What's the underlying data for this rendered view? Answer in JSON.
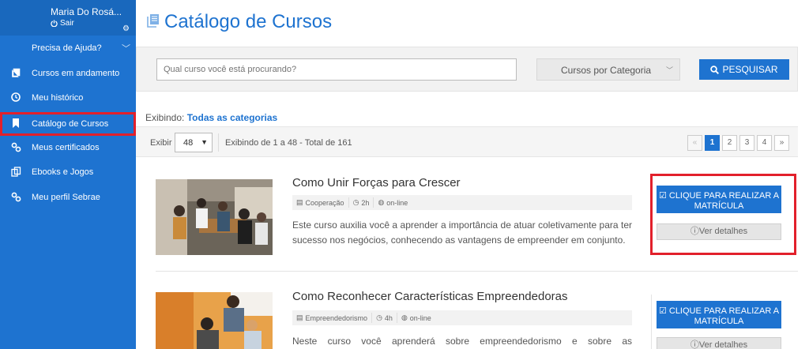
{
  "user": {
    "name": "Maria Do Rosá...",
    "logout_label": "Sair"
  },
  "sidebar": {
    "help_label": "Precisa de Ajuda?",
    "items": [
      {
        "label": "Cursos em andamento",
        "icon": "book-icon"
      },
      {
        "label": "Meu histórico",
        "icon": "clock-icon"
      },
      {
        "label": "Catálogo de Cursos",
        "icon": "bookmark-icon",
        "active": true
      },
      {
        "label": "Meus certificados",
        "icon": "link-icon"
      },
      {
        "label": "Ebooks e Jogos",
        "icon": "copy-icon"
      },
      {
        "label": "Meu perfil Sebrae",
        "icon": "link-icon"
      }
    ]
  },
  "page": {
    "title": "Catálogo de Cursos"
  },
  "search": {
    "placeholder": "Qual curso você está procurando?",
    "category_label": "Cursos por Categoria",
    "button_label": "PESQUISAR"
  },
  "filter": {
    "prefix": "Exibindo:",
    "value": "Todas as categorias"
  },
  "pagination": {
    "per_page_label": "Exibir",
    "per_page_value": "48",
    "range_text": "Exibindo de 1 a 48 - Total de 161",
    "prev": "«",
    "next": "»",
    "pages": [
      "1",
      "2",
      "3",
      "4"
    ],
    "current_page": "1"
  },
  "courses": [
    {
      "title": "Como Unir Forças para Crescer",
      "category": "Cooperação",
      "duration": "2h",
      "mode": "on-line",
      "description": "Este curso auxilia você a aprender a importância de atuar coletivamente para ter sucesso nos negócios, conhecendo as vantagens de empreender em conjunto.",
      "enroll_label": "CLIQUE PARA REALIZAR A MATRÍCULA",
      "details_label": "Ver detalhes"
    },
    {
      "title": "Como Reconhecer Características Empreendedoras",
      "category": "Empreendedorismo",
      "duration": "4h",
      "mode": "on-line",
      "description": "Neste curso você aprenderá sobre empreendedorismo e sobre as características",
      "enroll_label": "CLIQUE PARA REALIZAR A MATRÍCULA",
      "details_label": "Ver detalhes"
    }
  ],
  "colors": {
    "brand": "#1e73d0",
    "highlight": "#e2202b"
  }
}
